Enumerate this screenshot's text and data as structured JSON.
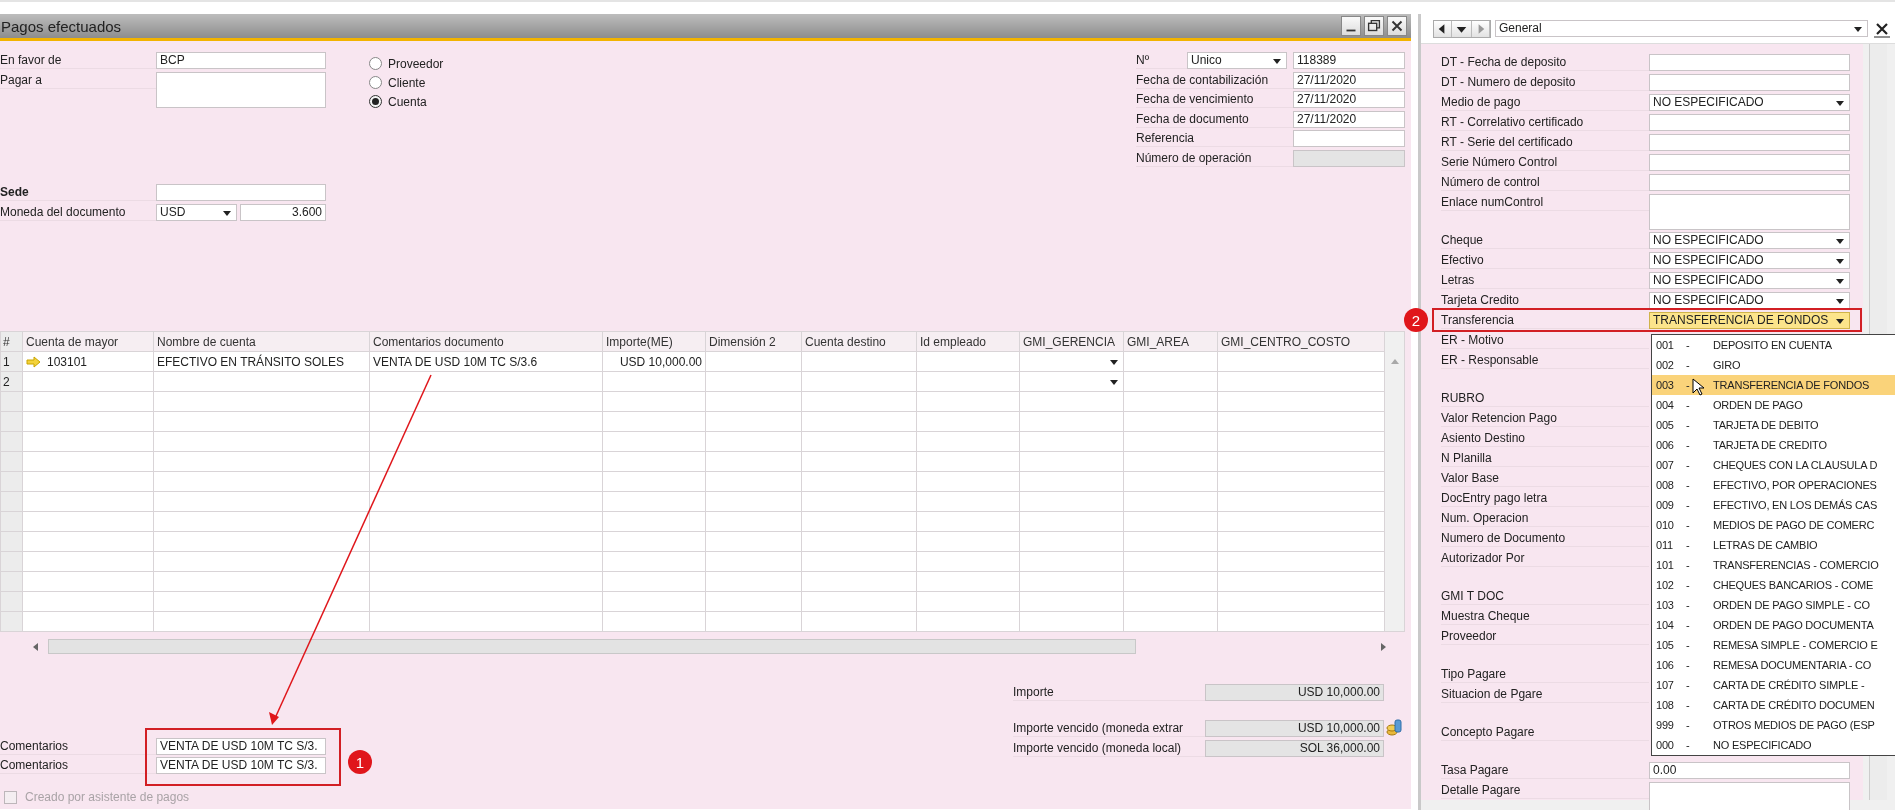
{
  "window": {
    "title": "Pagos efectuados"
  },
  "header_left": [
    {
      "label": "En favor de",
      "kind": "text",
      "value": "BCP"
    },
    {
      "label": "Pagar a",
      "kind": "memo"
    }
  ],
  "partner_type": [
    {
      "label": "Proveedor",
      "selected": false
    },
    {
      "label": "Cliente",
      "selected": false
    },
    {
      "label": "Cuenta",
      "selected": true
    }
  ],
  "branch": [
    {
      "label": "Sede",
      "kind": "text"
    },
    {
      "label": "Moneda del documento",
      "kind": "currency",
      "value": "USD",
      "rate": "3.600"
    }
  ],
  "header_right": [
    {
      "label": "Nº",
      "kind": "series",
      "series": "Unico",
      "value": "118389"
    },
    {
      "label": "Fecha de contabilización",
      "kind": "text",
      "value": "27/11/2020"
    },
    {
      "label": "Fecha de vencimiento",
      "kind": "text",
      "value": "27/11/2020"
    },
    {
      "label": "Fecha de documento",
      "kind": "text",
      "value": "27/11/2020"
    },
    {
      "label": "Referencia",
      "kind": "text"
    },
    {
      "label": "Número de operación",
      "kind": "readonly"
    }
  ],
  "table": {
    "columns": [
      "#",
      "Cuenta de mayor",
      "Nombre de cuenta",
      "Comentarios documento",
      "Importe(ME)",
      "Dimensión 2",
      "Cuenta destino",
      "Id empleado",
      "GMI_GERENCIA",
      "GMI_AREA",
      "GMI_CENTRO_COSTO"
    ],
    "rows": [
      {
        "number": "1",
        "linked": true,
        "account": "103101",
        "account_name": "EFECTIVO EN TRÁNSITO SOLES",
        "comments": "VENTA DE USD 10M TC S/3.6",
        "amount": "USD 10,000.00",
        "gerencia_dropdown": true
      },
      {
        "number": "2",
        "linked": false,
        "gerencia_dropdown": true
      }
    ]
  },
  "totals": [
    {
      "label": "Importe",
      "value": "USD 10,000.00",
      "kind": "plain"
    },
    {
      "label": "Importe vencido (moneda extrar",
      "value": "USD 10,000.00",
      "kind": "icon"
    },
    {
      "label": "Importe vencido (moneda local)",
      "value": "SOL 36,000.00",
      "kind": "plain"
    }
  ],
  "comments": [
    {
      "label": "Comentarios",
      "value": "VENTA DE USD 10M TC S/3."
    },
    {
      "label": "Comentarios",
      "value": "VENTA DE USD 10M TC S/3."
    }
  ],
  "wizard_checkbox": {
    "label": "Creado por asistente de pagos",
    "checked": false,
    "disabled": true
  },
  "udf_panel": {
    "category": "General",
    "fields": [
      {
        "label": "DT - Fecha de deposito",
        "kind": "text"
      },
      {
        "label": "DT - Numero de deposito",
        "kind": "text"
      },
      {
        "label": "Medio de pago",
        "kind": "dropdown",
        "value": "NO ESPECIFICADO",
        "highlighted": false
      },
      {
        "label": "RT - Correlativo certificado",
        "kind": "text"
      },
      {
        "label": "RT - Serie del certificado",
        "kind": "text"
      },
      {
        "label": "Serie Número Control",
        "kind": "text"
      },
      {
        "label": "Número de control",
        "kind": "text"
      },
      {
        "label": "Enlace numControl",
        "kind": "memo"
      },
      {
        "label": "Cheque",
        "kind": "dropdown",
        "value": "NO ESPECIFICADO",
        "highlighted": false
      },
      {
        "label": "Efectivo",
        "kind": "dropdown",
        "value": "NO ESPECIFICADO",
        "highlighted": false
      },
      {
        "label": "Letras",
        "kind": "dropdown",
        "value": "NO ESPECIFICADO",
        "highlighted": false
      },
      {
        "label": "Tarjeta Credito",
        "kind": "dropdown",
        "value": "NO ESPECIFICADO",
        "highlighted": false
      },
      {
        "label": "Transferencia",
        "kind": "dropdown",
        "value": "TRANSFERENCIA DE FONDOS",
        "highlighted": true
      },
      {
        "label": "ER - Motivo",
        "kind": "hidden"
      },
      {
        "label": "ER - Responsable",
        "kind": "hiddenmemo"
      },
      {
        "label": "RUBRO",
        "kind": "hidden"
      },
      {
        "label": "Valor Retencion Pago",
        "kind": "hidden"
      },
      {
        "label": "Asiento Destino",
        "kind": "hidden"
      },
      {
        "label": "N Planilla",
        "kind": "hidden"
      },
      {
        "label": "Valor Base",
        "kind": "hidden"
      },
      {
        "label": "DocEntry pago letra",
        "kind": "hidden"
      },
      {
        "label": "Num. Operacion",
        "kind": "hidden"
      },
      {
        "label": "Numero de Documento",
        "kind": "hidden"
      },
      {
        "label": "Autorizador Por",
        "kind": "hiddenmemo"
      },
      {
        "label": "GMI T DOC",
        "kind": "hidden"
      },
      {
        "label": "Muestra Cheque",
        "kind": "hidden"
      },
      {
        "label": "Proveedor",
        "kind": "hiddenmemo"
      },
      {
        "label": "Tipo Pagare",
        "kind": "hidden"
      },
      {
        "label": "Situacion de Pgare",
        "kind": "hiddenmemo"
      },
      {
        "label": "Concepto Pagare",
        "kind": "hiddenmemo"
      },
      {
        "label": "Tasa Pagare",
        "kind": "text",
        "value": "0.00"
      },
      {
        "label": "Detalle Pagare",
        "kind": "memo"
      }
    ]
  },
  "dropdown_list": [
    {
      "code": "001",
      "separator": "-",
      "label": "DEPOSITO EN CUENTA",
      "selected": false
    },
    {
      "code": "002",
      "separator": "-",
      "label": "GIRO",
      "selected": false
    },
    {
      "code": "003",
      "separator": "-",
      "label": "TRANSFERENCIA DE FONDOS",
      "selected": true
    },
    {
      "code": "004",
      "separator": "-",
      "label": "ORDEN DE PAGO",
      "selected": false
    },
    {
      "code": "005",
      "separator": "-",
      "label": "TARJETA DE DEBITO",
      "selected": false
    },
    {
      "code": "006",
      "separator": "-",
      "label": "TARJETA DE CREDITO",
      "selected": false
    },
    {
      "code": "007",
      "separator": "-",
      "label": "CHEQUES CON LA CLAUSULA D",
      "selected": false
    },
    {
      "code": "008",
      "separator": "-",
      "label": "EFECTIVO, POR OPERACIONES",
      "selected": false
    },
    {
      "code": "009",
      "separator": "-",
      "label": "EFECTIVO, EN LOS DEMÁS CAS",
      "selected": false
    },
    {
      "code": "010",
      "separator": "-",
      "label": "MEDIOS DE PAGO DE COMERC",
      "selected": false
    },
    {
      "code": "011",
      "separator": "-",
      "label": "LETRAS DE CAMBIO",
      "selected": false
    },
    {
      "code": "101",
      "separator": "-",
      "label": "TRANSFERENCIAS - COMERCIO",
      "selected": false
    },
    {
      "code": "102",
      "separator": "-",
      "label": "CHEQUES BANCARIOS - COME",
      "selected": false
    },
    {
      "code": "103",
      "separator": "-",
      "label": "ORDEN DE PAGO SIMPLE - CO",
      "selected": false
    },
    {
      "code": "104",
      "separator": "-",
      "label": "ORDEN DE PAGO DOCUMENTA",
      "selected": false
    },
    {
      "code": "105",
      "separator": "-",
      "label": "REMESA SIMPLE - COMERCIO E",
      "selected": false
    },
    {
      "code": "106",
      "separator": "-",
      "label": "REMESA DOCUMENTARIA - CO",
      "selected": false
    },
    {
      "code": "107",
      "separator": "-",
      "label": "CARTA DE CRÉDITO SIMPLE -",
      "selected": false
    },
    {
      "code": "108",
      "separator": "-",
      "label": "CARTA DE CRÉDITO DOCUMEN",
      "selected": false
    },
    {
      "code": "999",
      "separator": "-",
      "label": "OTROS MEDIOS DE PAGO (ESP",
      "selected": false
    },
    {
      "code": "000",
      "separator": "-",
      "label": "NO ESPECIFICADO",
      "selected": false
    }
  ],
  "annotations": [
    {
      "number": "1"
    },
    {
      "number": "2"
    }
  ]
}
